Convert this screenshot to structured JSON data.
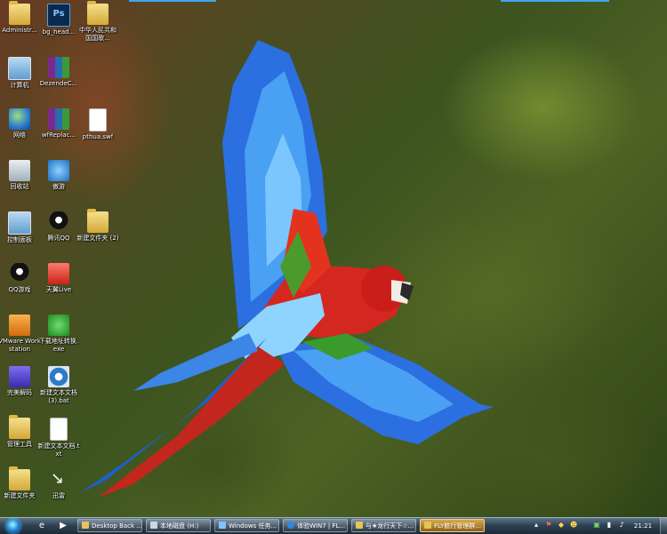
{
  "desktop_icons": [
    {
      "label": "Administr...",
      "icon": "folder-user-icon"
    },
    {
      "label": "bg_head...",
      "icon": "photoshop-file-icon",
      "badge": "Ps"
    },
    {
      "label": "中华人民共和国国歌...",
      "icon": "media-file-icon"
    },
    {
      "label": "计算机",
      "icon": "computer-icon"
    },
    {
      "label": "DezendeC...",
      "icon": "rar-archive-icon"
    },
    {
      "label": "网络",
      "icon": "network-icon"
    },
    {
      "label": "wfReplac...",
      "icon": "rar-archive-icon"
    },
    {
      "label": "pthua.swf",
      "icon": "document-icon"
    },
    {
      "label": "回收站",
      "icon": "recycle-bin-icon"
    },
    {
      "label": "傲游",
      "icon": "browser-icon"
    },
    {
      "label": "控制面板",
      "icon": "control-panel-icon"
    },
    {
      "label": "腾讯QQ",
      "icon": "qq-icon"
    },
    {
      "label": "新建文件夹 (2)",
      "icon": "folder-icon"
    },
    {
      "label": "QQ游戏",
      "icon": "qq-game-icon"
    },
    {
      "label": "天翼Live",
      "icon": "tianyi-live-icon"
    },
    {
      "label": "VMware Workstation",
      "icon": "vmware-icon"
    },
    {
      "label": "下载地址转换.exe",
      "icon": "converter-icon"
    },
    {
      "label": "完美解码",
      "icon": "media-player-icon"
    },
    {
      "label": "新建文本文档 (3).bat",
      "icon": "batch-file-icon"
    },
    {
      "label": "管理工具",
      "icon": "admin-tools-icon"
    },
    {
      "label": "新建文本文档.txt",
      "icon": "text-file-icon"
    },
    {
      "label": "新建文件夹",
      "icon": "folder-icon"
    },
    {
      "label": "迅雷",
      "icon": "thunder-icon"
    }
  ],
  "taskbar": {
    "start_icon": "windows-start-orb-icon",
    "quick_launch": [
      {
        "icon": "internet-explorer-icon"
      },
      {
        "icon": "media-player-icon"
      }
    ],
    "tasks": [
      {
        "label": "Desktop Back ...",
        "active": false
      },
      {
        "label": "本地磁盘 (H:)",
        "active": false
      },
      {
        "label": "Windows 任务...",
        "active": false
      },
      {
        "label": "体验WIN7 | FL...",
        "active": false
      },
      {
        "label": "与★龙行天下☆...",
        "active": false
      },
      {
        "label": "FLY航行管理群...",
        "active": true
      }
    ],
    "tray_icons": [
      "tray-arrow-icon",
      "tray-flag-icon",
      "tray-security-icon",
      "tray-people-icon",
      "tray-green-icon",
      "tray-signal-icon",
      "tray-volume-icon"
    ],
    "clock": "21:21"
  },
  "colors": {
    "taskbar_top": "#5b7489",
    "taskbar_bottom": "#1d2b38",
    "active_task": "#d9a84a",
    "wallpaper_green": "#3d5420"
  }
}
